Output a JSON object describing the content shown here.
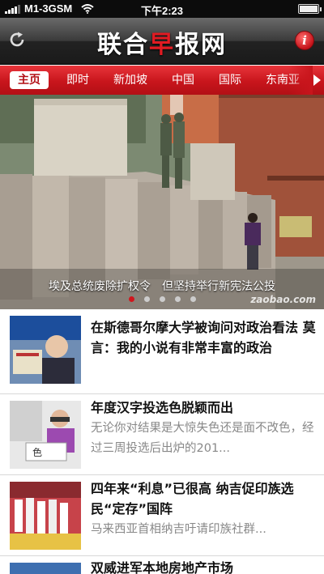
{
  "status": {
    "carrier": "M1-3GSM",
    "time": "下午2:23"
  },
  "header": {
    "logo_part1": "联合",
    "logo_accent": "早",
    "logo_part2": "报网",
    "info_label": "i"
  },
  "nav": {
    "tabs": [
      {
        "label": "主页",
        "active": true
      },
      {
        "label": "即时"
      },
      {
        "label": "新加坡"
      },
      {
        "label": "中国"
      },
      {
        "label": "国际"
      },
      {
        "label": "东南亚"
      }
    ]
  },
  "hero": {
    "caption": "埃及总统废除扩权令　但坚持举行新宪法公投",
    "watermark": "zaobao.com",
    "slide_count": 5,
    "active_slide": 1
  },
  "articles": [
    {
      "title": "在斯德哥尔摩大学被询问对政治看法 莫言：我的小说有非常丰富的政治",
      "summary": ""
    },
    {
      "title": "年度汉字投选色脱颖而出",
      "summary": "无论你对结果是大惊失色还是面不改色，经过三周投选后出炉的201..."
    },
    {
      "title": "四年来“利息”已很高 纳吉促印族选民“定存”国阵",
      "summary": "马来西亚首相纳吉吁请印族社群..."
    },
    {
      "title": "双威进军本地房地产市场",
      "summary": ""
    }
  ],
  "colors": {
    "brand_red": "#c8151c",
    "header_dark": "#222222"
  }
}
